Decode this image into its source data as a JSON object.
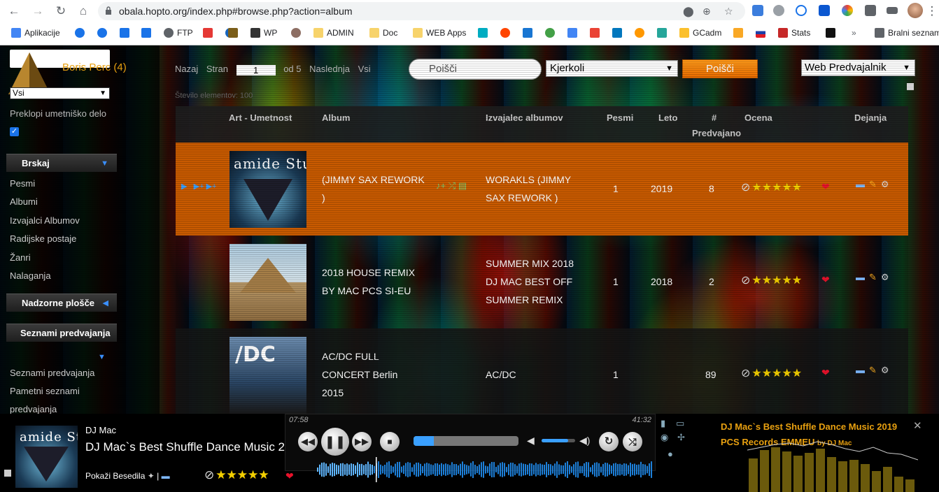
{
  "browser": {
    "url": "obala.hopto.org/index.php#browse.php?action=album",
    "bookmarks": [
      "Aplikacije",
      "FTP",
      "WP",
      "ADMIN",
      "Doc",
      "WEB Apps",
      "GCadm",
      "Stats",
      "Bralni seznam"
    ]
  },
  "sidebar": {
    "user_name": "Boris Perc (4)",
    "catalog_value": "Vsi",
    "art_toggle_label": "Preklopi umetniško delo",
    "browse_header": "Brskaj",
    "browse_items": [
      "Pesmi",
      "Albumi",
      "Izvajalci Albumov",
      "Radijske postaje",
      "Žanri",
      "Nalaganja"
    ],
    "dashboard_header": "Nadzorne plošče",
    "playlists_header": "Seznami predvajanja",
    "playlist_items": [
      "Seznami predvajanja",
      "Pametni seznami predvajanja"
    ]
  },
  "pager": {
    "prev": "Nazaj",
    "page": "Stran",
    "page_value": "1",
    "of": "od 5",
    "next": "Naslednja",
    "all": "Vsi",
    "item_count": "Število elementov: 100"
  },
  "search": {
    "placeholder": "Poišči",
    "type_value": "Kjerkoli",
    "button": "Poišči",
    "player_value": "Web Predvajalnik"
  },
  "table": {
    "headers": {
      "art": "Art - Umetnost",
      "album": "Album",
      "artist": "Izvajalec albumov",
      "songs": "Pesmi",
      "year": "Leto",
      "played_hash": "#",
      "played": "Predvajano",
      "rating": "Ocena",
      "actions": "Dejanja"
    },
    "rows": [
      {
        "album": "(JIMMY SAX REWORK )",
        "artist": "WORAKLS (JIMMY SAX REWORK )",
        "songs": "1",
        "year": "2019",
        "played": "8",
        "stars": 5,
        "cover": "amide Stu"
      },
      {
        "album": "2018 HOUSE REMIX BY MAC PCS SI-EU",
        "artist": "SUMMER MIX 2018 DJ MAC BEST OFF SUMMER REMIX",
        "songs": "1",
        "year": "2018",
        "played": "2",
        "stars": 5,
        "cover": ""
      },
      {
        "album": "AC/DC FULL CONCERT Berlin 2015",
        "artist": "AC/DC",
        "songs": "1",
        "year": "",
        "played": "89",
        "stars": 5,
        "cover": "/DC"
      }
    ]
  },
  "player": {
    "artist": "DJ Mac",
    "title": "DJ Mac`s Best Shuffle Dance Music 2019 PCS Records EMMEU by DJ Mac",
    "lyrics": "Pokaži Besedila",
    "elapsed": "07:58",
    "total": "41:32",
    "progress": 0.19,
    "volume": 0.8,
    "stars": 5,
    "info_title": "DJ Mac`s Best Shuffle Dance Music 2019 PCS Records EMMEU",
    "info_by": "by DJ Mac"
  },
  "colors": {
    "accent_orange": "#c85a00",
    "user_orange": "#e8a010",
    "blue": "#3aa0ff"
  }
}
